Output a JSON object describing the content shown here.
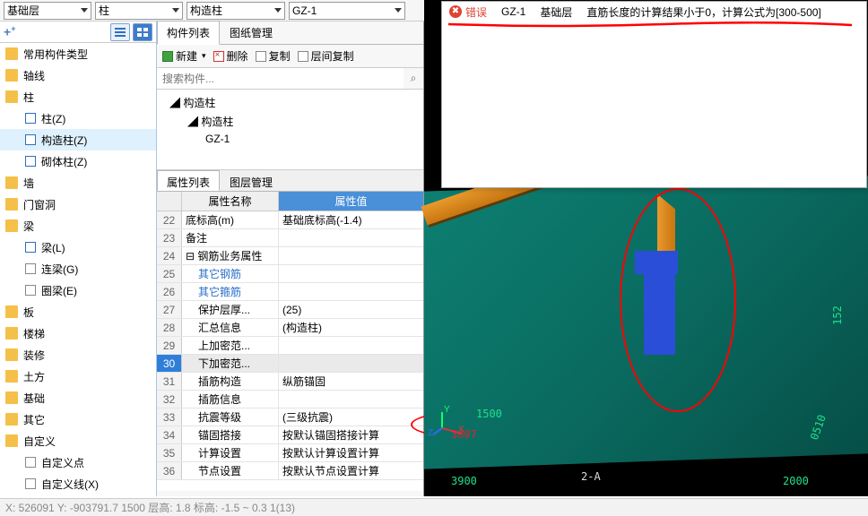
{
  "topbar": {
    "dd1": "基础层",
    "dd2": "柱",
    "dd3": "构造柱",
    "dd4": "GZ-1"
  },
  "left_tree": [
    {
      "label": "常用构件类型",
      "icon": "folder",
      "level": 0
    },
    {
      "label": "轴线",
      "icon": "folder",
      "level": 0
    },
    {
      "label": "柱",
      "icon": "folder",
      "level": 0
    },
    {
      "label": "柱(Z)",
      "icon": "col",
      "level": 1
    },
    {
      "label": "构造柱(Z)",
      "icon": "col",
      "level": 1,
      "sel": true
    },
    {
      "label": "砌体柱(Z)",
      "icon": "col",
      "level": 1
    },
    {
      "label": "墙",
      "icon": "folder",
      "level": 0
    },
    {
      "label": "门窗洞",
      "icon": "folder",
      "level": 0
    },
    {
      "label": "梁",
      "icon": "folder",
      "level": 0
    },
    {
      "label": "梁(L)",
      "icon": "col",
      "level": 1
    },
    {
      "label": "连梁(G)",
      "icon": "colg",
      "level": 1
    },
    {
      "label": "圈梁(E)",
      "icon": "colg",
      "level": 1
    },
    {
      "label": "板",
      "icon": "folder",
      "level": 0
    },
    {
      "label": "楼梯",
      "icon": "folder",
      "level": 0
    },
    {
      "label": "装修",
      "icon": "folder",
      "level": 0
    },
    {
      "label": "土方",
      "icon": "folder",
      "level": 0
    },
    {
      "label": "基础",
      "icon": "folder",
      "level": 0
    },
    {
      "label": "其它",
      "icon": "folder",
      "level": 0
    },
    {
      "label": "自定义",
      "icon": "folder",
      "level": 0
    },
    {
      "label": "自定义点",
      "icon": "colg",
      "level": 1
    },
    {
      "label": "自定义线(X)",
      "icon": "colg",
      "level": 1
    }
  ],
  "mid": {
    "tab1": "构件列表",
    "tab2": "图纸管理",
    "btn_new": "新建",
    "btn_del": "删除",
    "btn_copy": "复制",
    "btn_layercopy": "层间复制",
    "search_ph": "搜索构件...",
    "ct_root": "构造柱",
    "ct_child": "构造柱",
    "ct_leaf": "GZ-1"
  },
  "prop": {
    "tab1": "属性列表",
    "tab2": "图层管理",
    "hdr_name": "属性名称",
    "hdr_val": "属性值",
    "rows": [
      {
        "n": "22",
        "name": "底标高(m)",
        "val": "基础底标高(-1.4)"
      },
      {
        "n": "23",
        "name": "备注",
        "val": ""
      },
      {
        "n": "24",
        "name": "钢筋业务属性",
        "val": "",
        "collapsible": true
      },
      {
        "n": "25",
        "name": "其它钢筋",
        "val": "",
        "blue": true,
        "indent": true
      },
      {
        "n": "26",
        "name": "其它箍筋",
        "val": "",
        "blue": true,
        "indent": true
      },
      {
        "n": "27",
        "name": "保护层厚...",
        "val": "(25)",
        "indent": true
      },
      {
        "n": "28",
        "name": "汇总信息",
        "val": "(构造柱)",
        "indent": true
      },
      {
        "n": "29",
        "name": "上加密范...",
        "val": "",
        "indent": true
      },
      {
        "n": "30",
        "name": "下加密范...",
        "val": "",
        "indent": true,
        "selrow": true
      },
      {
        "n": "31",
        "name": "插筋构造",
        "val": "纵筋锚固",
        "indent": true,
        "hl": true
      },
      {
        "n": "32",
        "name": "插筋信息",
        "val": "",
        "indent": true
      },
      {
        "n": "33",
        "name": "抗震等级",
        "val": "(三级抗震)",
        "indent": true
      },
      {
        "n": "34",
        "name": "锚固搭接",
        "val": "按默认锚固搭接计算",
        "indent": true
      },
      {
        "n": "35",
        "name": "计算设置",
        "val": "按默认计算设置计算",
        "indent": true
      },
      {
        "n": "36",
        "name": "节点设置",
        "val": "按默认节点设置计算",
        "indent": true
      }
    ]
  },
  "popup": {
    "err_label": "错误",
    "gz": "GZ-1",
    "floor": "基础层",
    "msg": "直筋长度的计算结果小于0，计算公式为[300-500]"
  },
  "dims": {
    "d1": "1500",
    "d2": "3007",
    "d3": "3900",
    "d4": "152",
    "d5": "0510",
    "d6": "2000"
  },
  "axis": {
    "x": "X",
    "y": "Y",
    "z": "Z"
  },
  "gridmark": "2-A",
  "status": "X: 526091 Y: -903791.7   1500   层高: 1.8   标高: -1.5 ~ 0.3   1(13)"
}
